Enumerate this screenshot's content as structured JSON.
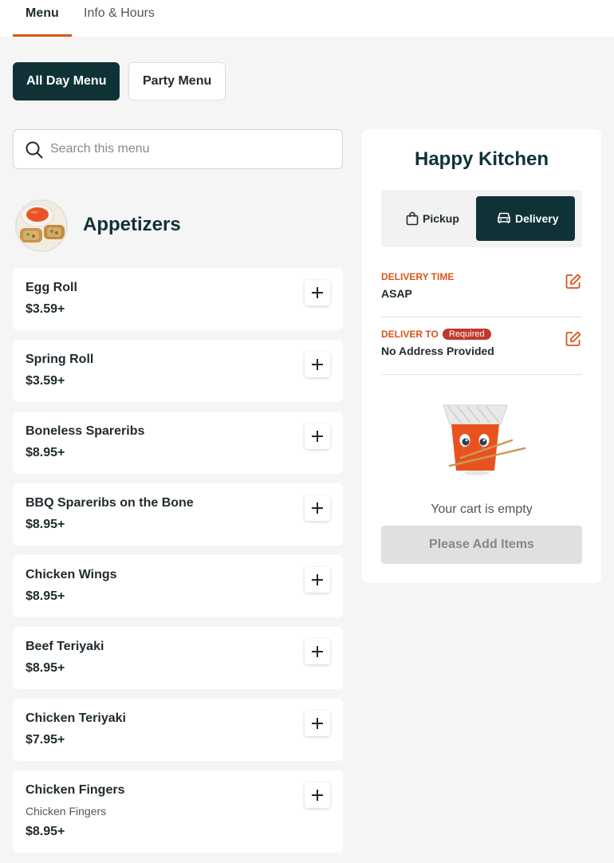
{
  "nav": {
    "tabs": [
      {
        "label": "Menu"
      },
      {
        "label": "Info & Hours"
      }
    ]
  },
  "menus": [
    {
      "label": "All Day Menu"
    },
    {
      "label": "Party Menu"
    }
  ],
  "search": {
    "placeholder": "Search this menu"
  },
  "category": {
    "title": "Appetizers"
  },
  "items": [
    {
      "name": "Egg Roll",
      "price": "$3.59+"
    },
    {
      "name": "Spring Roll",
      "price": "$3.59+"
    },
    {
      "name": "Boneless Spareribs",
      "price": "$8.95+"
    },
    {
      "name": "BBQ Spareribs on the Bone",
      "price": "$8.95+"
    },
    {
      "name": "Chicken Wings",
      "price": "$8.95+"
    },
    {
      "name": "Beef Teriyaki",
      "price": "$8.95+"
    },
    {
      "name": "Chicken Teriyaki",
      "price": "$7.95+"
    },
    {
      "name": "Chicken Fingers",
      "description": "Chicken Fingers",
      "price": "$8.95+"
    }
  ],
  "cart": {
    "restaurant": "Happy Kitchen",
    "modes": {
      "pickup": "Pickup",
      "delivery": "Delivery",
      "selected": "Delivery"
    },
    "delivery_time": {
      "label": "DELIVERY TIME",
      "value": "ASAP"
    },
    "deliver_to": {
      "label": "DELIVER TO",
      "badge": "Required",
      "value": "No Address Provided"
    },
    "empty_text": "Your cart is empty",
    "cta": "Please Add Items"
  },
  "colors": {
    "accent": "#e0531f",
    "dark": "#0f3237",
    "badge": "#c0392b"
  },
  "icons": [
    "search-icon",
    "plus-icon",
    "bag-icon",
    "car-icon",
    "edit-icon"
  ]
}
